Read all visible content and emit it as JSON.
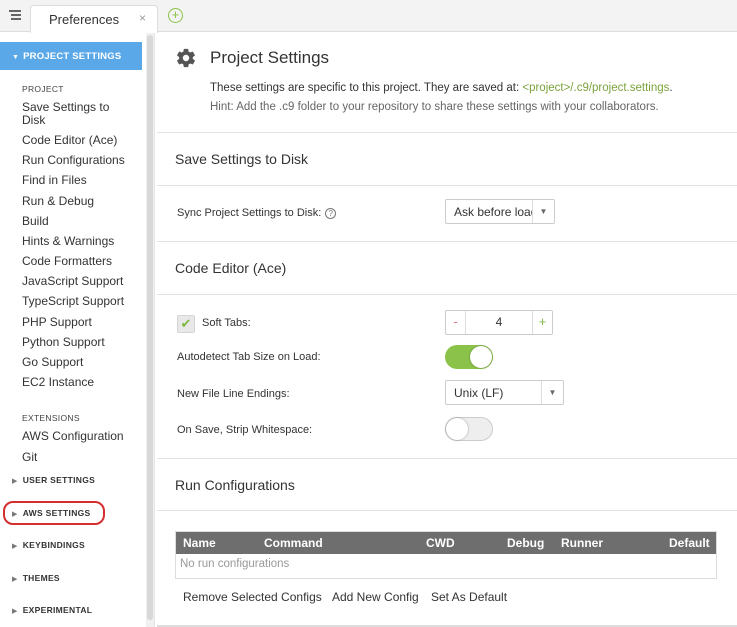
{
  "tabbar": {
    "tab_title": "Preferences",
    "close_glyph": "×",
    "add_glyph": "+"
  },
  "sidebar": {
    "active_section": "PROJECT SETTINGS",
    "groups": {
      "project": "PROJECT",
      "extensions": "EXTENSIONS"
    },
    "project_items": [
      "Save Settings to Disk",
      "Code Editor (Ace)",
      "Run Configurations",
      "Find in Files",
      "Run & Debug",
      "Build",
      "Hints & Warnings",
      "Code Formatters",
      "JavaScript Support",
      "TypeScript Support",
      "PHP Support",
      "Python Support",
      "Go Support",
      "EC2 Instance"
    ],
    "extension_items": [
      "AWS Configuration",
      "Git"
    ],
    "collapsed_sections": [
      "USER SETTINGS",
      "AWS SETTINGS",
      "KEYBINDINGS",
      "THEMES",
      "EXPERIMENTAL"
    ]
  },
  "main": {
    "title": "Project Settings",
    "desc_prefix": "These settings are specific to this project. They are saved at: ",
    "desc_path": "<project>/.c9/project.settings",
    "desc_suffix": ".",
    "hint": "Hint: Add the .c9 folder to your repository to share these settings with your collaborators.",
    "save_section": {
      "title": "Save Settings to Disk",
      "sync_label": "Sync Project Settings to Disk:",
      "sync_value": "Ask before load"
    },
    "editor_section": {
      "title": "Code Editor (Ace)",
      "soft_tabs_label": "Soft Tabs:",
      "soft_tabs_checked": true,
      "tab_size": "4",
      "autodetect_label": "Autodetect Tab Size on Load:",
      "autodetect_on": true,
      "line_endings_label": "New File Line Endings:",
      "line_endings_value": "Unix (LF)",
      "strip_label": "On Save, Strip Whitespace:",
      "strip_on": false
    },
    "run_section": {
      "title": "Run Configurations",
      "columns": [
        "Name",
        "Command",
        "CWD",
        "Debug",
        "Runner",
        "Default"
      ],
      "empty_text": "No run configurations",
      "buttons": [
        "Remove Selected Configs",
        "Add New Config",
        "Set As Default"
      ]
    }
  },
  "colors": {
    "accent_blue": "#5ba8e8",
    "accent_green": "#8bc34a",
    "annotation_red": "#d32f2f"
  }
}
